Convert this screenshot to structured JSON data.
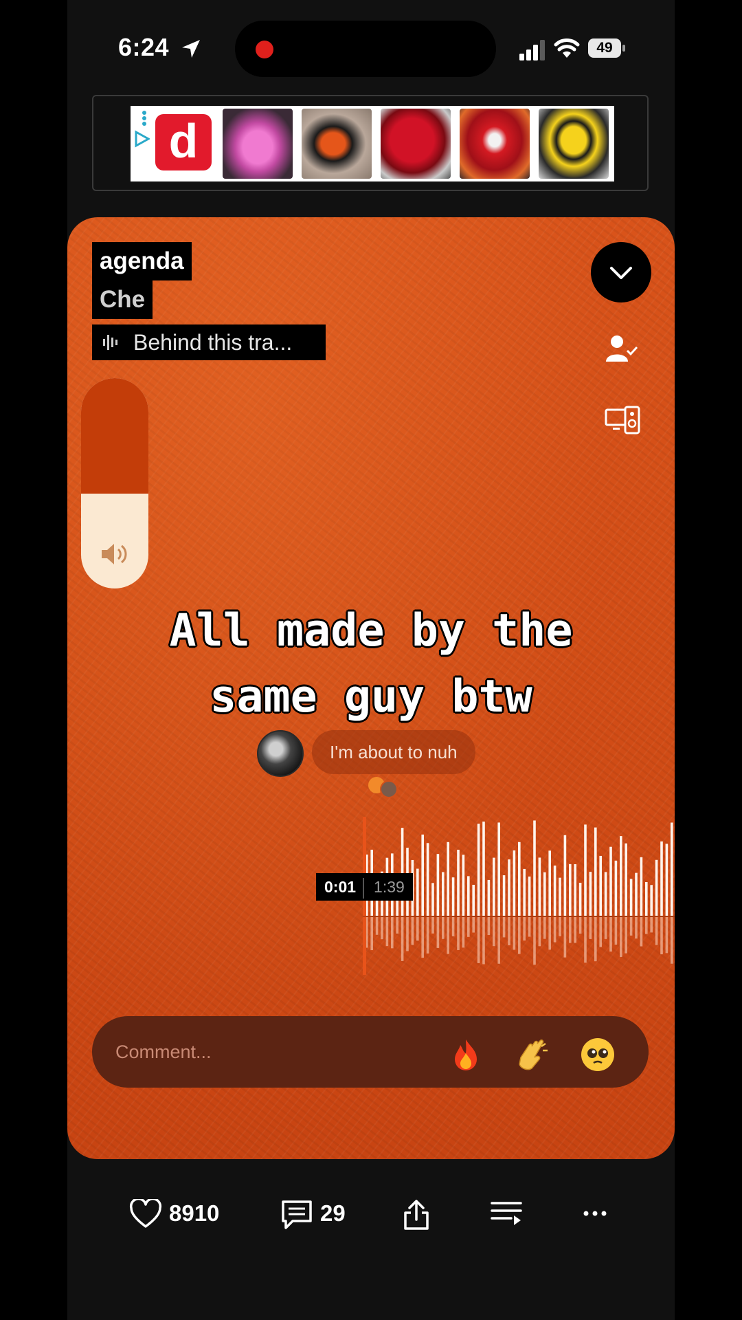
{
  "status_bar": {
    "time": "6:24",
    "battery": "49"
  },
  "ad": {
    "logo_letter": "d"
  },
  "player": {
    "track_title": "agenda",
    "artist": "Che",
    "behind_label": "Behind this tra...",
    "volume_level": 0.45,
    "caption_line1": "All made by the",
    "caption_line2": "same guy btw",
    "comment_bubble": "I'm about to nuh",
    "current_time": "0:01",
    "duration": "1:39",
    "comment_placeholder": "Comment...",
    "reactions": [
      "🔥",
      "👏",
      "🥹"
    ]
  },
  "actions": {
    "likes": "8910",
    "comments": "29"
  },
  "colors": {
    "accent": "#d9531a",
    "card_dark": "#5c2413",
    "volume_fill": "#c33d09"
  }
}
